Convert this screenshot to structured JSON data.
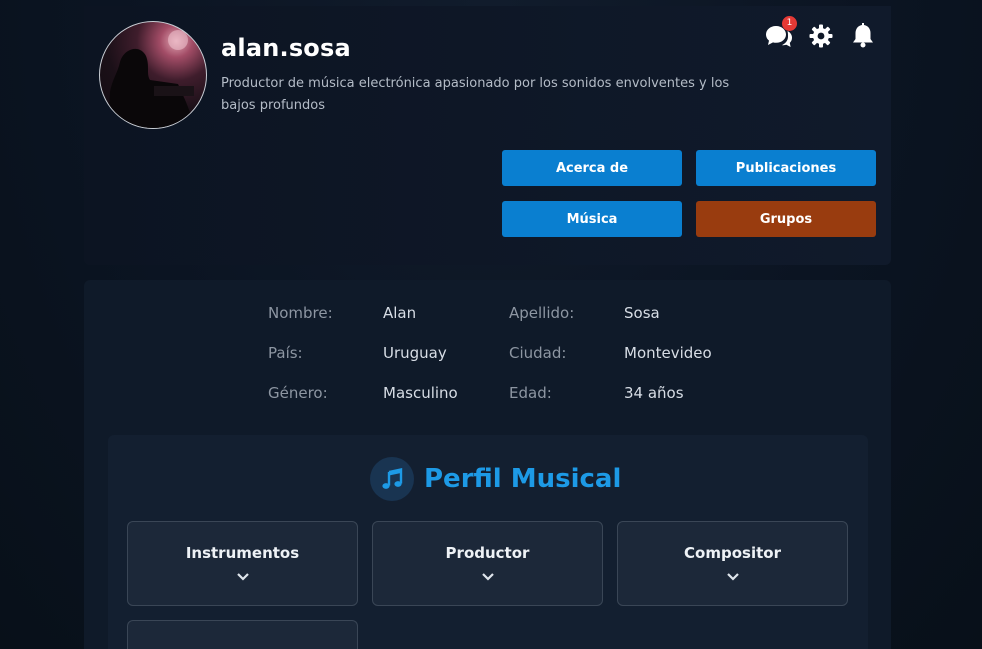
{
  "profile": {
    "username": "alan.sosa",
    "bio": "Productor de música electrónica apasionado por los sonidos envolventes y los bajos profundos",
    "notification_count": "1"
  },
  "header_icons": [
    "chat-bubbles-icon",
    "gear-icon",
    "bell-icon"
  ],
  "nav_buttons": [
    {
      "label": "Acerca de",
      "color": "#0a7fd0"
    },
    {
      "label": "Publicaciones",
      "color": "#0a7fd0"
    },
    {
      "label": "Música",
      "color": "#0a7fd0"
    },
    {
      "label": "Grupos",
      "color": "#993c0f"
    }
  ],
  "info": {
    "rows": [
      [
        {
          "label": "Nombre:",
          "value": "Alan"
        },
        {
          "label": "Apellido:",
          "value": "Sosa"
        }
      ],
      [
        {
          "label": "País:",
          "value": "Uruguay"
        },
        {
          "label": "Ciudad:",
          "value": "Montevideo"
        }
      ],
      [
        {
          "label": "Género:",
          "value": "Masculino"
        },
        {
          "label": "Edad:",
          "value": "34 años"
        }
      ]
    ]
  },
  "music_profile": {
    "title": "Perfil Musical",
    "accent": "#1d9ae6",
    "tiles": [
      {
        "label": "Instrumentos"
      },
      {
        "label": "Productor"
      },
      {
        "label": "Compositor"
      },
      {
        "label": ""
      }
    ]
  }
}
